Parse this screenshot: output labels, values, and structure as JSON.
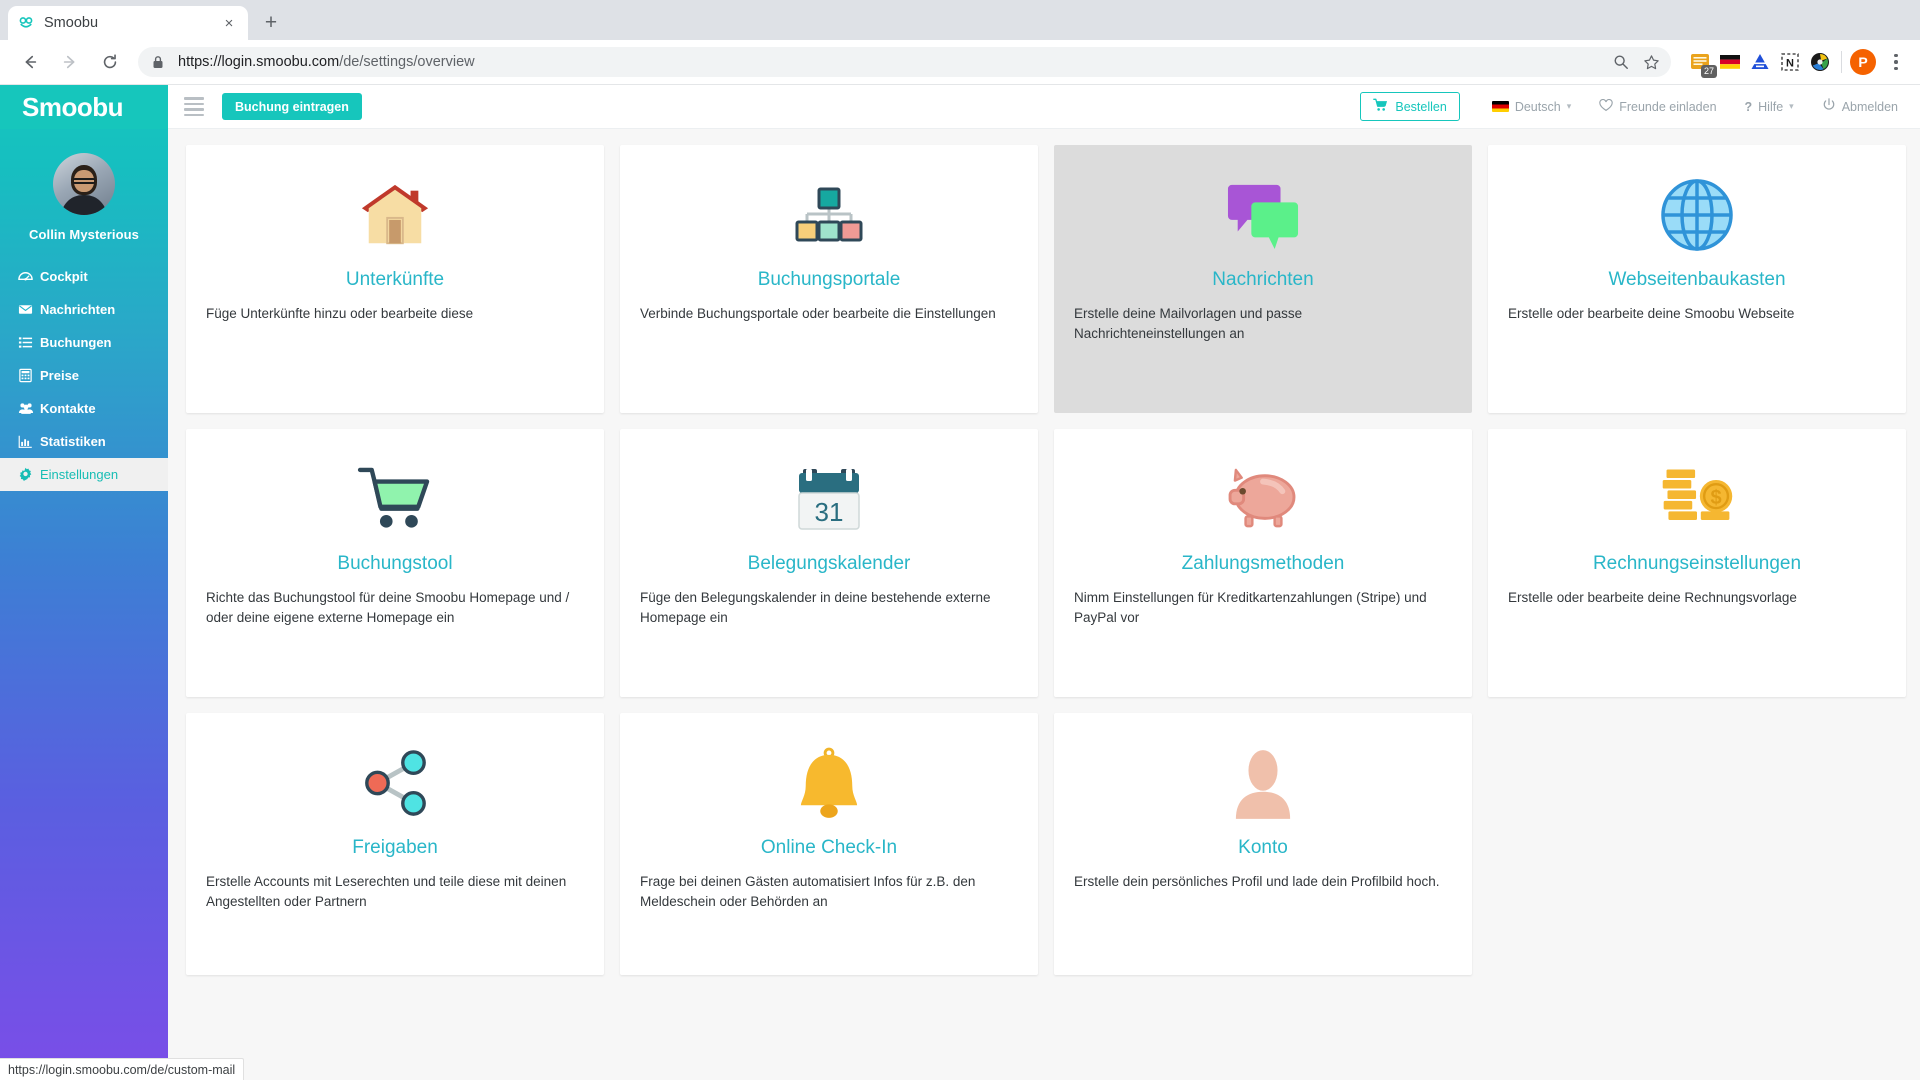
{
  "browser": {
    "tab": {
      "title": "Smoobu",
      "favicon": "smoobu-logo-icon",
      "close_label": "×"
    },
    "new_tab_label": "+",
    "nav": {
      "back": "←",
      "forward": "→",
      "reload": "↻"
    },
    "omnibox": {
      "lock": "lock-icon",
      "url_prefix": "https://login.smoobu.com",
      "url_path": "/de/settings/overview",
      "zoom_icon": "search-zoom-icon",
      "bookmark_icon": "star-icon"
    },
    "extensions": [
      {
        "name": "todoist-extension-icon",
        "badge": "27"
      },
      {
        "name": "german-flag-translate-icon",
        "badge": ""
      },
      {
        "name": "blue-triangle-extension-icon",
        "badge": ""
      },
      {
        "name": "notion-clipper-icon",
        "badge": ""
      },
      {
        "name": "colorzilla-extension-icon",
        "badge": ""
      }
    ],
    "profile_initial": "P",
    "menu_label": "chrome-menu"
  },
  "sidebar": {
    "brand": "Smoobu",
    "profile_name": "Collin Mysterious",
    "items": [
      {
        "label": "Cockpit",
        "icon": "dashboard-icon",
        "active": false
      },
      {
        "label": "Nachrichten",
        "icon": "envelope-icon",
        "active": false
      },
      {
        "label": "Buchungen",
        "icon": "list-icon",
        "active": false
      },
      {
        "label": "Preise",
        "icon": "calculator-icon",
        "active": false
      },
      {
        "label": "Kontakte",
        "icon": "users-icon",
        "active": false
      },
      {
        "label": "Statistiken",
        "icon": "bar-chart-icon",
        "active": false
      },
      {
        "label": "Einstellungen",
        "icon": "gear-icon",
        "active": true
      }
    ]
  },
  "appbar": {
    "menu_toggle": "hamburger-icon",
    "new_booking_label": "Buchung eintragen",
    "order_label": "Bestellen",
    "language_label": "Deutsch",
    "invite_label": "Freunde einladen",
    "help_label": "Hilfe",
    "logout_label": "Abmelden"
  },
  "cards": [
    {
      "title": "Unterkünfte",
      "desc": "Füge Unterkünfte hinzu oder bearbeite diese",
      "icon": "house-icon",
      "hovered": false
    },
    {
      "title": "Buchungsportale",
      "desc": "Verbinde Buchungsportale oder bearbeite die Einstellungen",
      "icon": "sitemap-icon",
      "hovered": false
    },
    {
      "title": "Nachrichten",
      "desc": "Erstelle deine Mailvorlagen und passe Nachrichteneinstellungen an",
      "icon": "speech-bubbles-icon",
      "hovered": true
    },
    {
      "title": "Webseitenbaukasten",
      "desc": "Erstelle oder bearbeite deine Smoobu Webseite",
      "icon": "globe-icon",
      "hovered": false
    },
    {
      "title": "Buchungstool",
      "desc": "Richte das Buchungstool für deine Smoobu Homepage und / oder deine eigene externe Homepage ein",
      "icon": "shopping-cart-icon",
      "hovered": false
    },
    {
      "title": "Belegungskalender",
      "desc": "Füge den Belegungskalender in deine bestehende externe Homepage ein",
      "icon": "calendar-icon",
      "icon_day": "31",
      "hovered": false
    },
    {
      "title": "Zahlungsmethoden",
      "desc": "Nimm Einstellungen für Kreditkartenzahlungen (Stripe) und PayPal vor",
      "icon": "piggy-bank-icon",
      "hovered": false
    },
    {
      "title": "Rechnungseinstellungen",
      "desc": "Erstelle oder bearbeite deine Rechnungsvorlage",
      "icon": "money-coin-icon",
      "hovered": false
    },
    {
      "title": "Freigaben",
      "desc": "Erstelle Accounts mit Leserechten und teile diese mit deinen Angestellten oder Partnern",
      "icon": "share-nodes-icon",
      "hovered": false
    },
    {
      "title": "Online Check-In",
      "desc": "Frage bei deinen Gästen automatisiert Infos für z.B. den Meldeschein oder Behörden an",
      "icon": "bell-icon",
      "hovered": false
    },
    {
      "title": "Konto",
      "desc": "Erstelle dein persönliches Profil und lade dein Profilbild hoch.",
      "icon": "person-silhouette-icon",
      "hovered": false
    }
  ],
  "statusbar": {
    "link": "https://login.smoobu.com/de/custom-mail"
  },
  "colors": {
    "brand_teal": "#16c6bc",
    "card_title": "#29b6c8",
    "hover_card_bg": "#dcdcdc",
    "sidebar_gradient_start": "#17c6bd",
    "sidebar_gradient_end": "#7b4de8"
  }
}
